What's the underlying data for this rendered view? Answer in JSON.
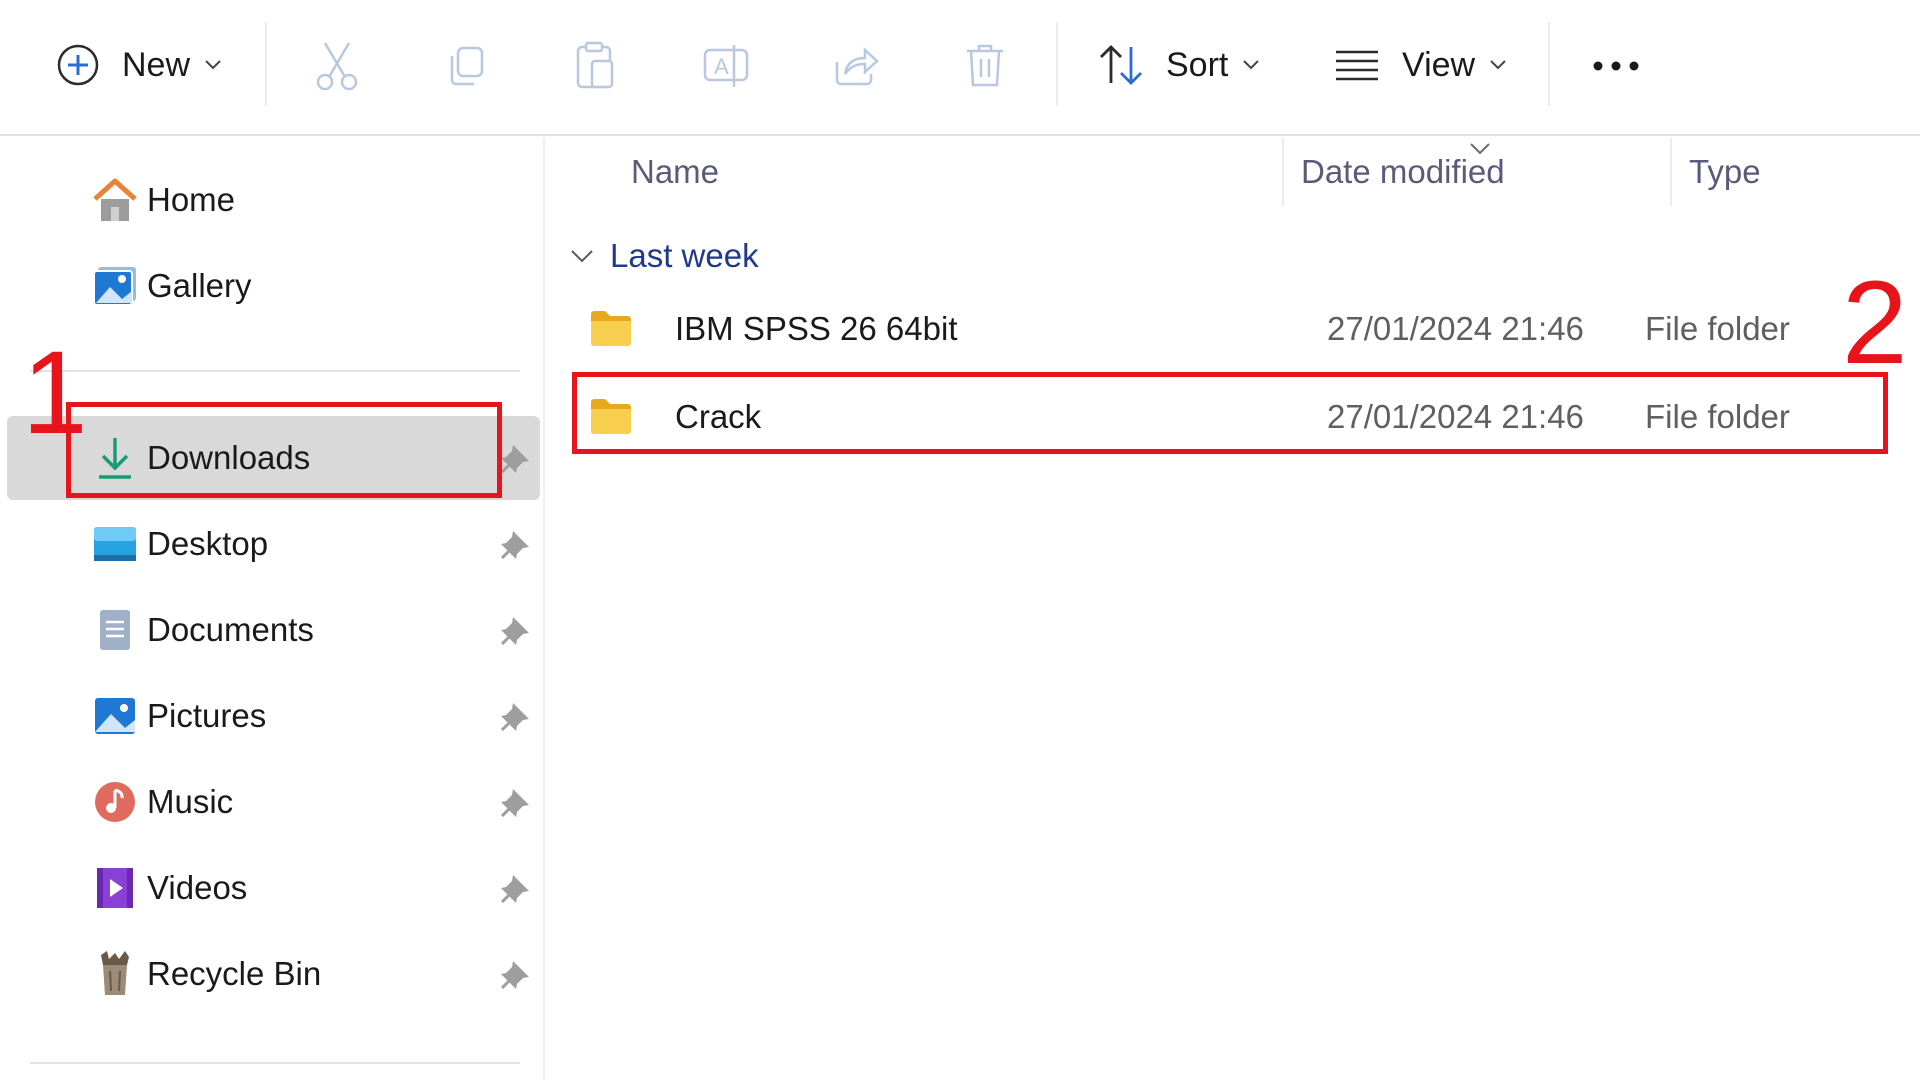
{
  "toolbar": {
    "new_label": "New",
    "sort_label": "Sort",
    "view_label": "View",
    "icons": [
      "plus-circle-icon",
      "cut-icon",
      "copy-icon",
      "paste-icon",
      "rename-icon",
      "share-icon",
      "delete-icon",
      "sort-icon",
      "view-icon",
      "more-icon"
    ]
  },
  "sidebar": {
    "items": [
      {
        "label": "Home",
        "icon": "home-icon"
      },
      {
        "label": "Gallery",
        "icon": "gallery-icon"
      },
      {
        "label": "Downloads",
        "icon": "download-icon",
        "selected": true,
        "pinned": true
      },
      {
        "label": "Desktop",
        "icon": "desktop-icon",
        "pinned": true
      },
      {
        "label": "Documents",
        "icon": "documents-icon",
        "pinned": true
      },
      {
        "label": "Pictures",
        "icon": "pictures-icon",
        "pinned": true
      },
      {
        "label": "Music",
        "icon": "music-icon",
        "pinned": true
      },
      {
        "label": "Videos",
        "icon": "videos-icon",
        "pinned": true
      },
      {
        "label": "Recycle Bin",
        "icon": "recycle-bin-icon",
        "pinned": true
      }
    ]
  },
  "file_list": {
    "columns": [
      "Name",
      "Date modified",
      "Type"
    ],
    "sort_column": "Date modified",
    "group": "Last week",
    "rows": [
      {
        "name": "IBM SPSS 26 64bit",
        "date": "27/01/2024 21:46",
        "type": "File folder"
      },
      {
        "name": "Crack",
        "date": "27/01/2024 21:46",
        "type": "File folder"
      }
    ]
  },
  "annotations": {
    "step1": "1",
    "step2": "2",
    "color": "#e8141b"
  },
  "colors": {
    "selected_bg": "#d9d9d9",
    "group_text": "#1f3a8a",
    "folder_yellow": "#f5c342"
  }
}
